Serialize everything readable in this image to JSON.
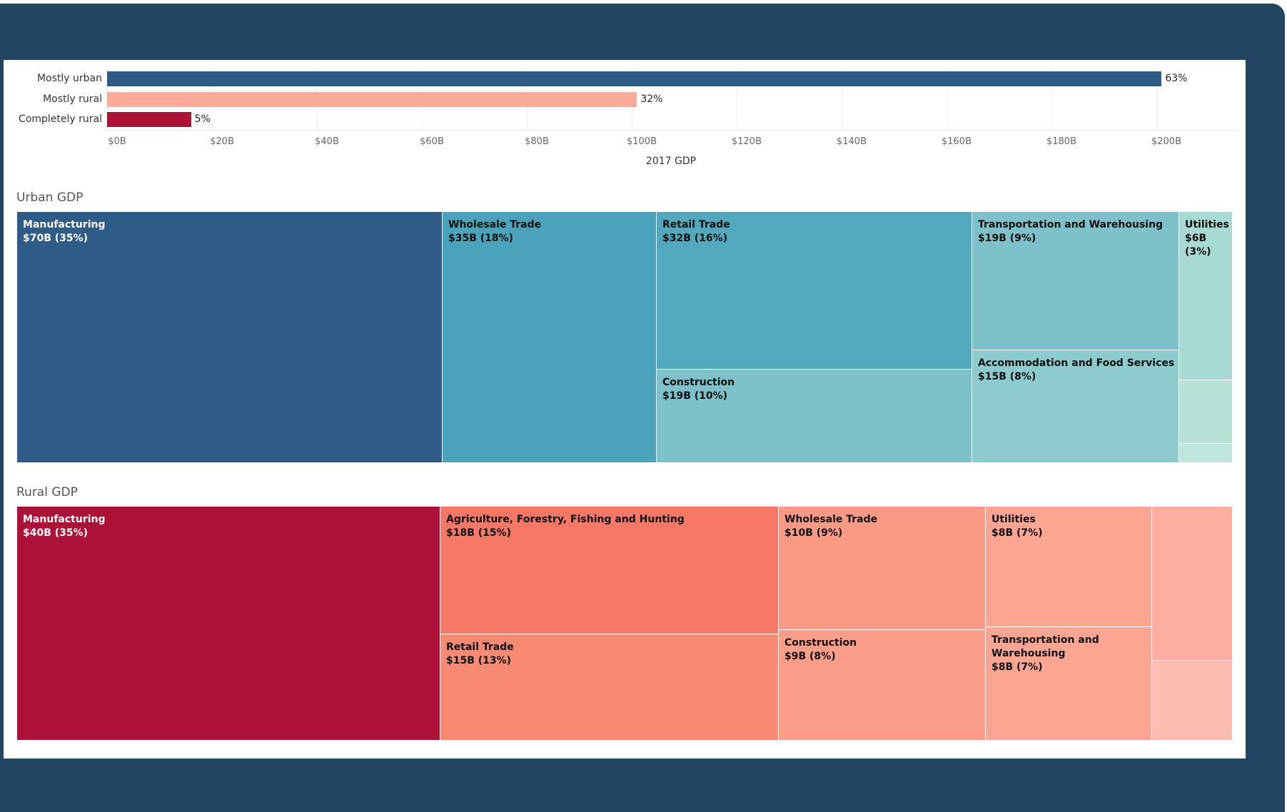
{
  "colors": {
    "frame": "#234561",
    "urban": "#2e5c87",
    "rural_bar": "#fbab9b",
    "completely_rural": "#ac1237"
  },
  "chart_data": [
    {
      "type": "bar",
      "orientation": "horizontal",
      "categories": [
        "Mostly urban",
        "Mostly rural",
        "Completely rural"
      ],
      "values": [
        201,
        101,
        16
      ],
      "data_labels": [
        "63%",
        "32%",
        "5%"
      ],
      "bar_colors": [
        "#2e5c87",
        "#fbab9b",
        "#ac1237"
      ],
      "xlabel": "2017 GDP",
      "xlim": [
        0,
        215
      ],
      "x_ticks": [
        0,
        20,
        40,
        60,
        80,
        100,
        120,
        140,
        160,
        180,
        200
      ],
      "x_tick_labels": [
        "$0B",
        "$20B",
        "$40B",
        "$60B",
        "$80B",
        "$100B",
        "$120B",
        "$140B",
        "$160B",
        "$180B",
        "$200B"
      ],
      "grid": true
    },
    {
      "type": "treemap",
      "title": "Urban GDP",
      "tiles": [
        {
          "name": "Manufacturing",
          "label": "Manufacturing\n$70B (35%)",
          "value": 70,
          "share": 35,
          "color": "#2e5c87",
          "text_color": "#ffffff"
        },
        {
          "name": "Wholesale Trade",
          "label": "Wholesale Trade\n$35B (18%)",
          "value": 35,
          "share": 18,
          "color": "#4aa3ba",
          "text_color": "#111111"
        },
        {
          "name": "Retail Trade",
          "label": "Retail Trade\n$32B (16%)",
          "value": 32,
          "share": 16,
          "color": "#52a9bd",
          "text_color": "#111111"
        },
        {
          "name": "Construction",
          "label": "Construction\n$19B (10%)",
          "value": 19,
          "share": 10,
          "color": "#7fc1ca",
          "text_color": "#111111"
        },
        {
          "name": "Transportation and Warehousing",
          "label": "Transportation and Warehousing\n$19B (9%)",
          "value": 19,
          "share": 9,
          "color": "#7fc1ca",
          "text_color": "#111111"
        },
        {
          "name": "Accommodation and Food Services",
          "label": "Accommodation and Food Services\n$15B (8%)",
          "value": 15,
          "share": 8,
          "color": "#8ecbcf",
          "text_color": "#111111"
        },
        {
          "name": "Utilities",
          "label": "Utilities\n$6B\n(3%)",
          "value": 6,
          "share": 3,
          "color": "#a8dad3",
          "text_color": "#111111"
        },
        {
          "name": "unlabeled-1",
          "label": "",
          "color": "#b6e2d7",
          "text_color": "#111111"
        },
        {
          "name": "unlabeled-2",
          "label": "",
          "color": "#bfe6dc",
          "text_color": "#111111"
        }
      ]
    },
    {
      "type": "treemap",
      "title": "Rural GDP",
      "tiles": [
        {
          "name": "Manufacturing",
          "label": "Manufacturing\n$40B (35%)",
          "value": 40,
          "share": 35,
          "color": "#ac1237",
          "text_color": "#ffffff"
        },
        {
          "name": "Agriculture, Forestry, Fishing and Hunting",
          "label": "Agriculture, Forestry, Fishing and Hunting\n$18B (15%)",
          "value": 18,
          "share": 15,
          "color": "#f57765",
          "text_color": "#111111"
        },
        {
          "name": "Retail Trade",
          "label": "Retail Trade\n$15B (13%)",
          "value": 15,
          "share": 13,
          "color": "#f88a73",
          "text_color": "#111111"
        },
        {
          "name": "Wholesale Trade",
          "label": "Wholesale Trade\n$10B (9%)",
          "value": 10,
          "share": 9,
          "color": "#fa9a85",
          "text_color": "#111111"
        },
        {
          "name": "Construction",
          "label": "Construction\n$9B (8%)",
          "value": 9,
          "share": 8,
          "color": "#fa9e89",
          "text_color": "#111111"
        },
        {
          "name": "Utilities",
          "label": "Utilities\n$8B (7%)",
          "value": 8,
          "share": 7,
          "color": "#fba592",
          "text_color": "#111111"
        },
        {
          "name": "Transportation and Warehousing",
          "label": "Transportation and\nWarehousing\n$8B (7%)",
          "value": 8,
          "share": 7,
          "color": "#fba592",
          "text_color": "#111111"
        },
        {
          "name": "unlabeled-1",
          "label": "",
          "color": "#fcaea0",
          "text_color": "#111111"
        },
        {
          "name": "unlabeled-2",
          "label": "",
          "color": "#fdbdb0",
          "text_color": "#111111"
        }
      ]
    }
  ]
}
